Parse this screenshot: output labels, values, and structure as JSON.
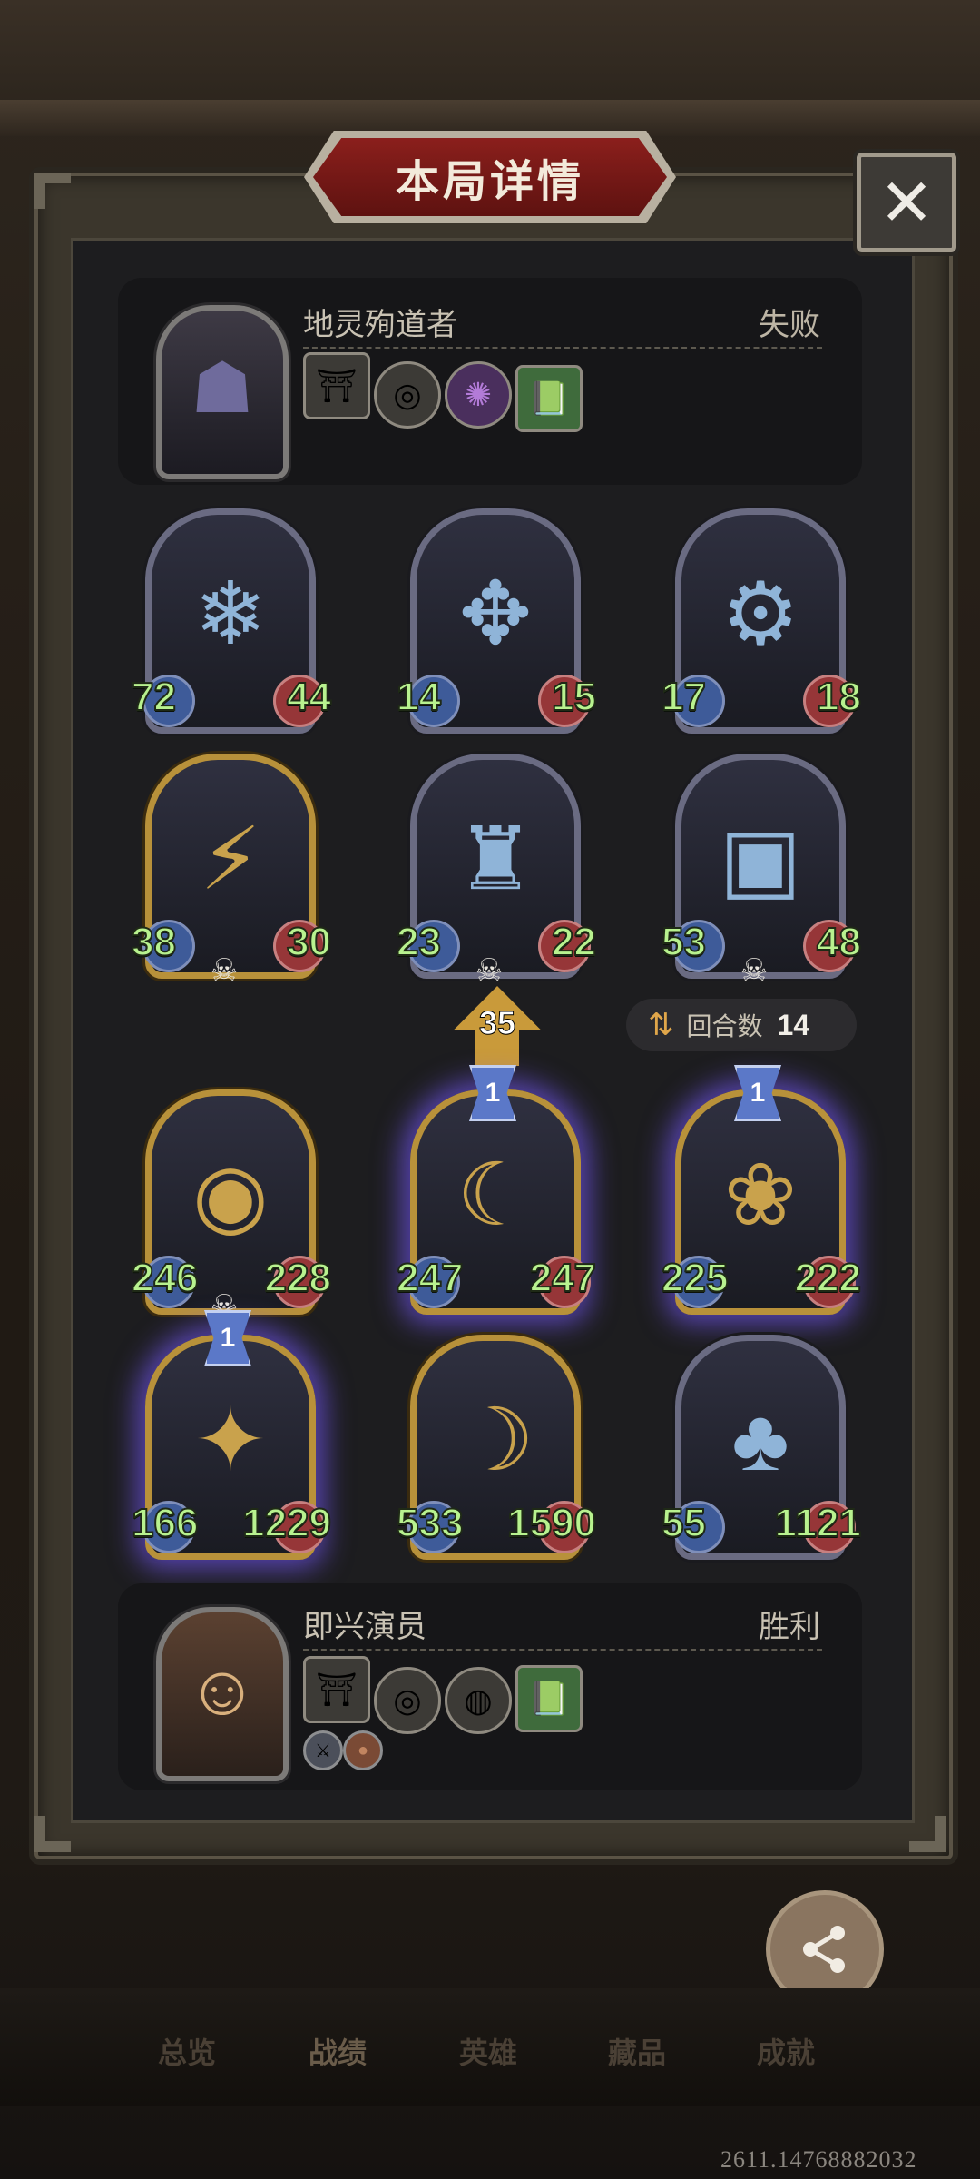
{
  "title": "本局详情",
  "close_icon": "✕",
  "opponent": {
    "name": "地灵殉道者",
    "result": "失败",
    "portrait_icon": "hooded-shade-icon",
    "items": [
      {
        "icon": "shrine-icon",
        "glyph": "⛩"
      },
      {
        "icon": "compass-icon",
        "glyph": "◎"
      },
      {
        "icon": "purple-orb-icon",
        "glyph": "✺"
      },
      {
        "icon": "green-book-icon",
        "glyph": "📗"
      }
    ]
  },
  "player": {
    "name": "即兴演员",
    "result": "胜利",
    "portrait_icon": "jester-man-icon",
    "items": [
      {
        "icon": "shrine-icon",
        "glyph": "⛩"
      },
      {
        "icon": "compass-icon",
        "glyph": "◎"
      },
      {
        "icon": "cauldron-icon",
        "glyph": "◍"
      },
      {
        "icon": "green-book-icon",
        "glyph": "📗"
      }
    ],
    "badges": [
      {
        "icon": "crossed-swords-icon",
        "glyph": "⚔"
      },
      {
        "icon": "copper-coin-icon",
        "glyph": "●"
      }
    ]
  },
  "opponent_board": [
    {
      "atk": "72",
      "hp": "44",
      "icon": "ice-elemental-icon",
      "glyph": "❄",
      "frame": "silver",
      "dead": false
    },
    {
      "atk": "14",
      "hp": "15",
      "icon": "windmill-icon",
      "glyph": "✥",
      "frame": "silver",
      "dead": false
    },
    {
      "atk": "17",
      "hp": "18",
      "icon": "golden-robot-icon",
      "glyph": "⚙",
      "frame": "silver",
      "dead": false
    },
    {
      "atk": "38",
      "hp": "30",
      "icon": "dark-robot-icon",
      "glyph": "⚡",
      "frame": "gold",
      "dead": true
    },
    {
      "atk": "23",
      "hp": "22",
      "icon": "dark-knight-icon",
      "glyph": "♜",
      "frame": "silver",
      "dead": true
    },
    {
      "atk": "53",
      "hp": "48",
      "icon": "box-robot-icon",
      "glyph": "▣",
      "frame": "silver",
      "dead": true
    }
  ],
  "damage": "35",
  "turn": {
    "label": "回合数",
    "value": "14",
    "icon": "swap-arrows-icon"
  },
  "player_board": [
    {
      "atk": "246",
      "hp": "228",
      "icon": "purple-idol-icon",
      "glyph": "◉",
      "frame": "gold",
      "glow": false,
      "dead": true,
      "tier": ""
    },
    {
      "atk": "247",
      "hp": "247",
      "icon": "moon-witch-icon",
      "glyph": "☾",
      "frame": "gold",
      "glow": true,
      "dead": false,
      "tier": "1"
    },
    {
      "atk": "225",
      "hp": "222",
      "icon": "pink-imp-icon",
      "glyph": "❀",
      "frame": "gold",
      "glow": true,
      "dead": false,
      "tier": "1"
    },
    {
      "atk": "166",
      "hp": "1229",
      "icon": "shadow-mage-icon",
      "glyph": "✦",
      "frame": "gold",
      "glow": true,
      "dead": false,
      "tier": "1"
    },
    {
      "atk": "533",
      "hp": "1590",
      "icon": "hooded-sorceress-icon",
      "glyph": "☽",
      "frame": "gold",
      "glow": false,
      "dead": false,
      "tier": ""
    },
    {
      "atk": "55",
      "hp": "1121",
      "icon": "clown-icon",
      "glyph": "♣",
      "frame": "silver",
      "glow": false,
      "dead": false,
      "tier": ""
    }
  ],
  "share": {
    "label": "分享",
    "icon": "share-icon"
  },
  "nav": [
    "总览",
    "战绩",
    "英雄",
    "藏品",
    "成就"
  ],
  "uid": "2611.14768882032"
}
